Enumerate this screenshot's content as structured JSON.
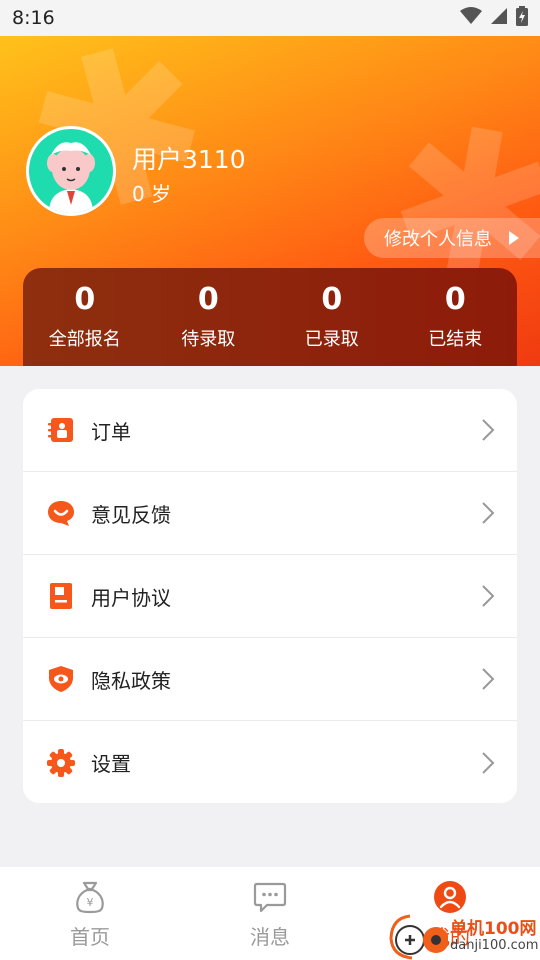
{
  "status_bar": {
    "time": "8:16"
  },
  "profile": {
    "name": "用户3110",
    "age": "0 岁",
    "edit_button": "修改个人信息"
  },
  "stats": [
    {
      "value": "0",
      "label": "全部报名"
    },
    {
      "value": "0",
      "label": "待录取"
    },
    {
      "value": "0",
      "label": "已录取"
    },
    {
      "value": "0",
      "label": "已结束"
    }
  ],
  "menu": [
    {
      "label": "订单",
      "icon": "order-icon"
    },
    {
      "label": "意见反馈",
      "icon": "feedback-icon"
    },
    {
      "label": "用户协议",
      "icon": "agreement-icon"
    },
    {
      "label": "隐私政策",
      "icon": "privacy-icon"
    },
    {
      "label": "设置",
      "icon": "settings-icon"
    }
  ],
  "bottom_nav": [
    {
      "label": "首页",
      "icon": "home-moneybag-icon",
      "active": false
    },
    {
      "label": "消息",
      "icon": "message-icon",
      "active": false
    },
    {
      "label": "我的",
      "icon": "profile-icon",
      "active": true
    }
  ],
  "watermark": {
    "title": "单机100网",
    "url": "danji100.com"
  },
  "colors": {
    "accent": "#f04a14",
    "header_start": "#ffc21a",
    "header_end": "#f03a10",
    "stats_bg": "#8e1b0a"
  }
}
